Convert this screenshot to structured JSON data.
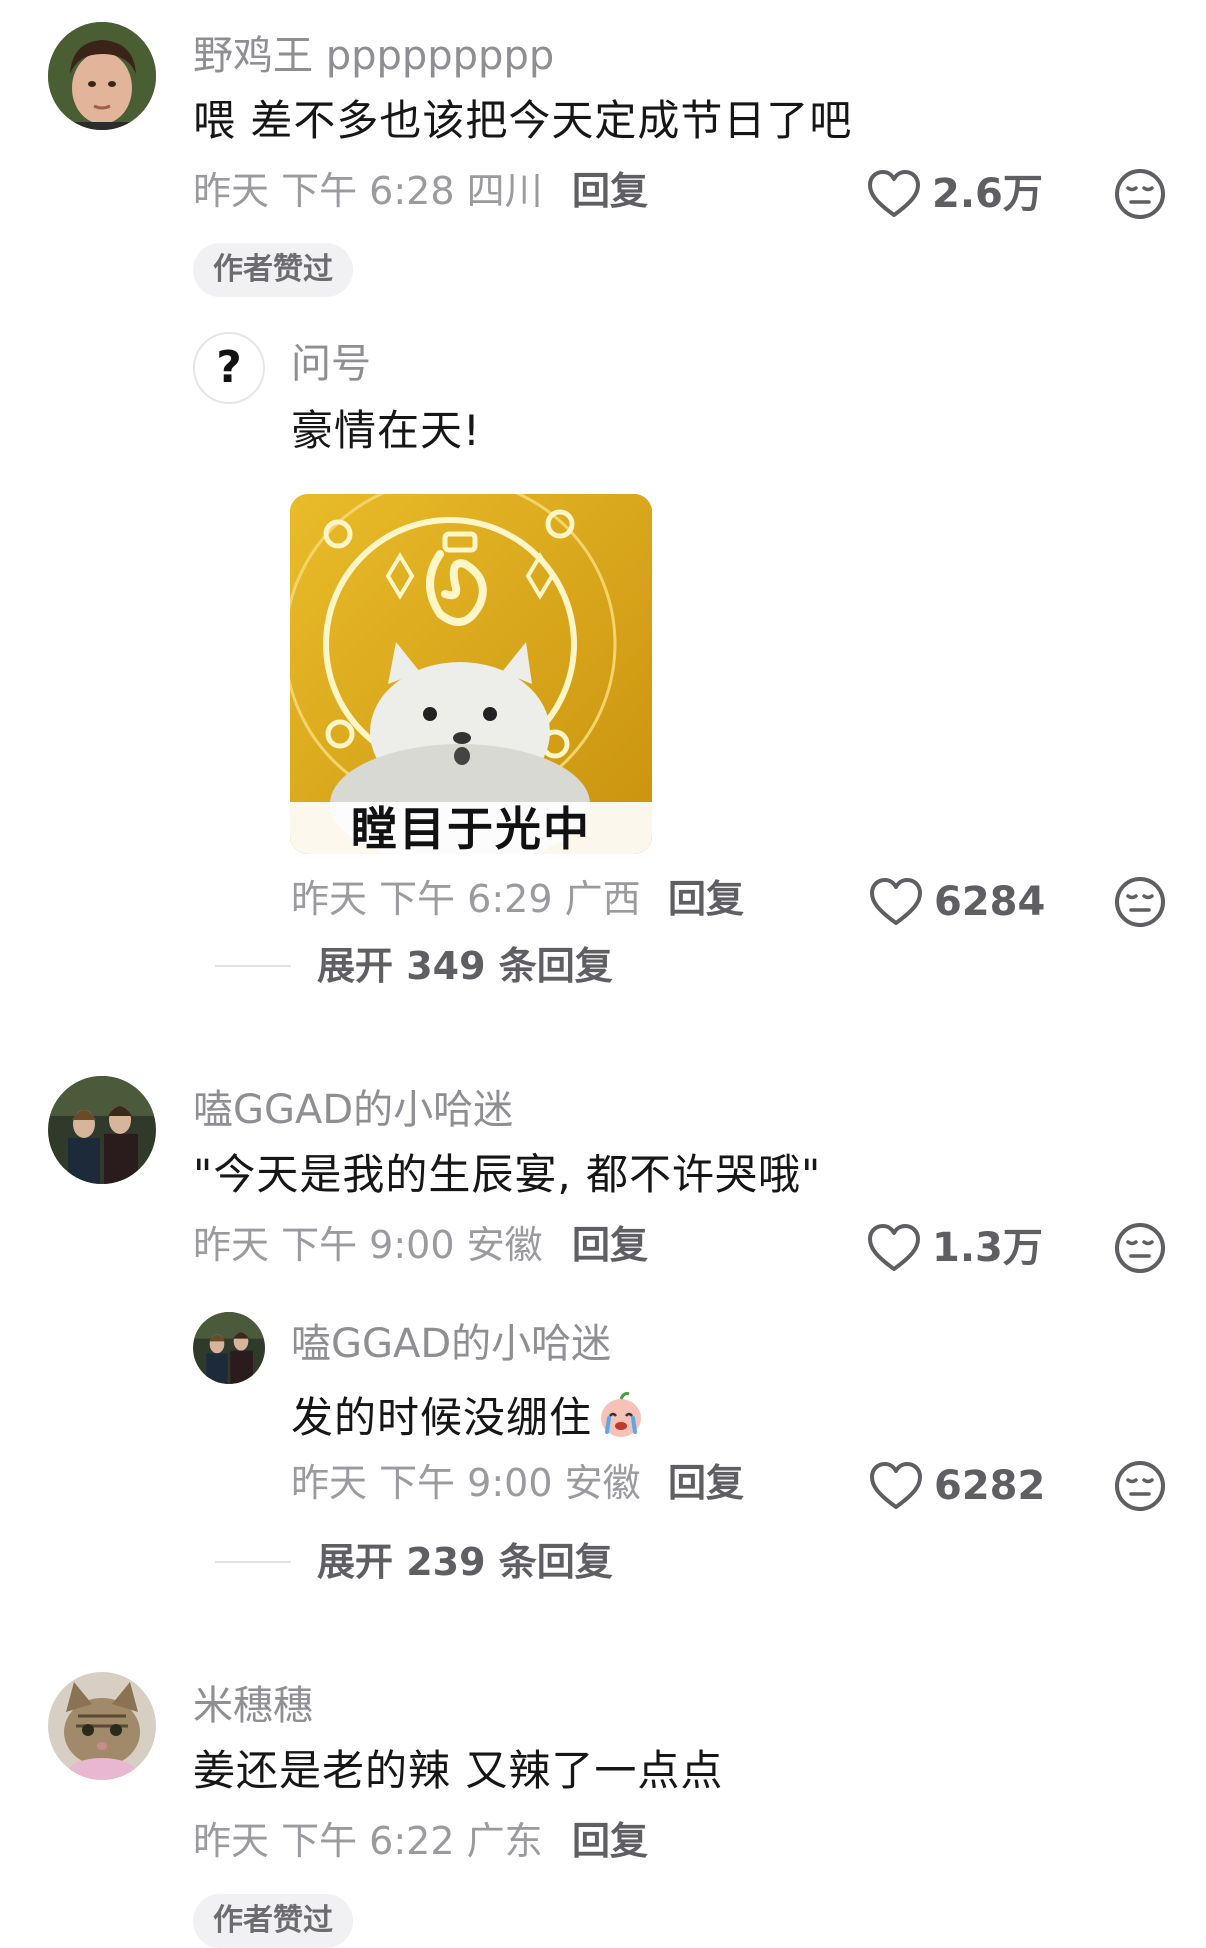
{
  "comments": [
    {
      "username": "野鸡王 ppppppppp",
      "content": "喂 差不多也该把今天定成节日了吧",
      "time": "昨天 下午 6:28 四川",
      "reply_label": "回复",
      "likes": "2.6万",
      "badge": "作者赞过",
      "reply": {
        "username": "问号",
        "avatar_glyph": "?",
        "content": "豪情在天!",
        "sticker_caption": "瞠目于光中",
        "time": "昨天 下午 6:29 广西",
        "reply_label": "回复",
        "likes": "6284"
      },
      "expand_label": "展开 349 条回复"
    },
    {
      "username": "嗑GGAD的小哈迷",
      "content": "\"今天是我的生辰宴, 都不许哭哦\"",
      "time": "昨天 下午 9:00 安徽",
      "reply_label": "回复",
      "likes": "1.3万",
      "reply": {
        "username": "嗑GGAD的小哈迷",
        "content": "发的时候没绷住",
        "time": "昨天 下午 9:00 安徽",
        "reply_label": "回复",
        "likes": "6282"
      },
      "expand_label": "展开 239 条回复"
    },
    {
      "username": "米穗穗",
      "content": "姜还是老的辣 又辣了一点点",
      "time": "昨天 下午 6:22 广东",
      "reply_label": "回复",
      "badge": "作者赞过"
    }
  ],
  "icons": {
    "like": "heart-outline-icon",
    "dislike": "meh-face-icon",
    "crying_emoji": "crying-emoji-icon"
  },
  "colors": {
    "username": "#8e8e93",
    "meta": "#9a9a9f",
    "text": "#161616",
    "badge_bg": "#f1f1f3",
    "sticker_gold": "#e3b21c"
  }
}
